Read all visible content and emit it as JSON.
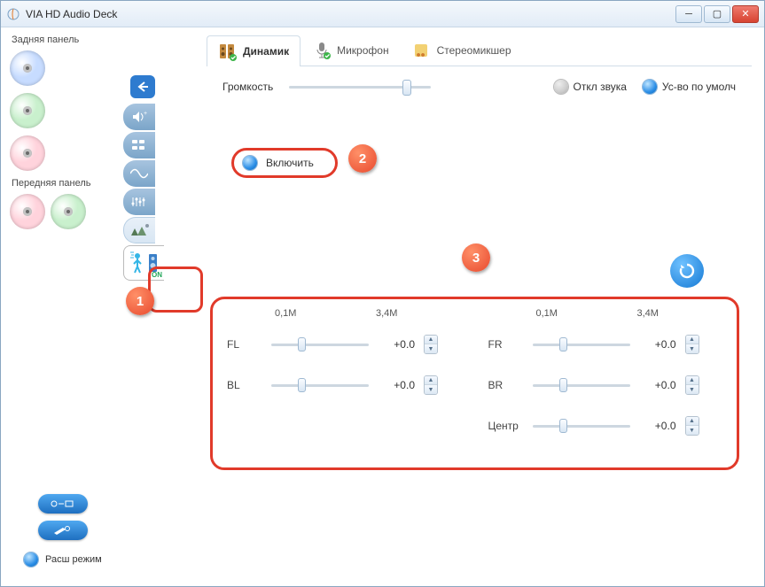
{
  "window": {
    "title": "VIA HD Audio Deck"
  },
  "left": {
    "rear_label": "Задняя панель",
    "front_label": "Передняя панель",
    "mode_label": "Расш режим",
    "human_on": "ON"
  },
  "tabs": {
    "speaker": "Динамик",
    "mic": "Микрофон",
    "stereomix": "Стереомикшер"
  },
  "vol": {
    "label": "Громкость",
    "mute": "Откл звука",
    "default": "Ус-во по умолч"
  },
  "enable": {
    "label": "Включить"
  },
  "scale": {
    "min": "0,1M",
    "max": "3,4M"
  },
  "channels": {
    "left": [
      {
        "name": "FL",
        "value": "+0.0"
      },
      {
        "name": "BL",
        "value": "+0.0"
      }
    ],
    "right": [
      {
        "name": "FR",
        "value": "+0.0"
      },
      {
        "name": "BR",
        "value": "+0.0"
      },
      {
        "name": "Центр",
        "value": "+0.0"
      }
    ]
  },
  "callouts": {
    "c1": "1",
    "c2": "2",
    "c3": "3"
  }
}
